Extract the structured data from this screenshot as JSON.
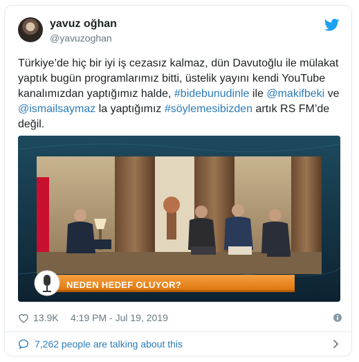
{
  "author": {
    "display_name": "yavuz oğhan",
    "handle": "@yavuzoghan"
  },
  "tweet": {
    "text_part1": "Türkiye’de hiç bir iyi iş cezasız kalmaz, dün Davutoğlu ile mülakat yaptık bugün programlarımız bitti, üstelik yayını kendi YouTube kanalımızdan yaptığımız halde, ",
    "hashtag1": "#bidebunudinle",
    "text_part2": " ile ",
    "mention1": "@makifbeki",
    "text_part3": " ve ",
    "mention2": "@ismailsaymaz",
    "text_part4": " la yaptığımız ",
    "hashtag2": "#söylemesibizden",
    "text_part5": " artık RS FM’de değil."
  },
  "media": {
    "lower_third_text": "NEDEN HEDEF OLUYOR?"
  },
  "meta": {
    "likes": "13.9K",
    "timestamp": "4:19 PM - Jul 19, 2019"
  },
  "footer": {
    "talking_text": "7,262 people are talking about this"
  },
  "colors": {
    "link": "#2b7bb9",
    "muted": "#697882",
    "twitter_blue": "#1da1f2",
    "lower_third_orange": "#f08a1c"
  }
}
